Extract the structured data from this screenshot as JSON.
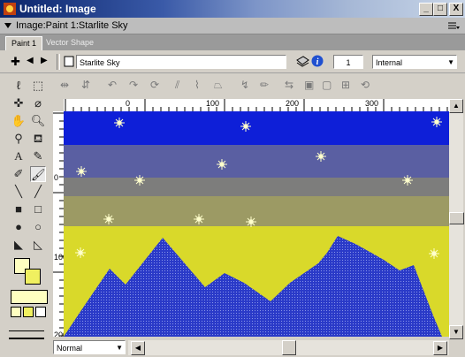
{
  "window": {
    "title": "Untitled: Image",
    "min": "_",
    "max": "□",
    "close": "X"
  },
  "header": {
    "title": "Image:Paint 1:Starlite Sky"
  },
  "tabs": [
    {
      "label": "Paint 1"
    },
    {
      "label": "Vector Shape"
    }
  ],
  "toolbar": {
    "name_value": "Starlite Sky",
    "number_value": "1",
    "ink_value": "Internal"
  },
  "ruler": {
    "h_labels": [
      "0",
      "100",
      "200",
      "300"
    ],
    "v_labels": [
      "0",
      "100",
      "200"
    ]
  },
  "status": {
    "blend_mode": "Normal"
  },
  "colors": {
    "bands": [
      "#0e1fd8",
      "#5a5fa2",
      "#7d7d7c",
      "#9c9a64",
      "#d9d92a"
    ],
    "mountain": "#2a3ac8",
    "star": "#ffffcc"
  }
}
